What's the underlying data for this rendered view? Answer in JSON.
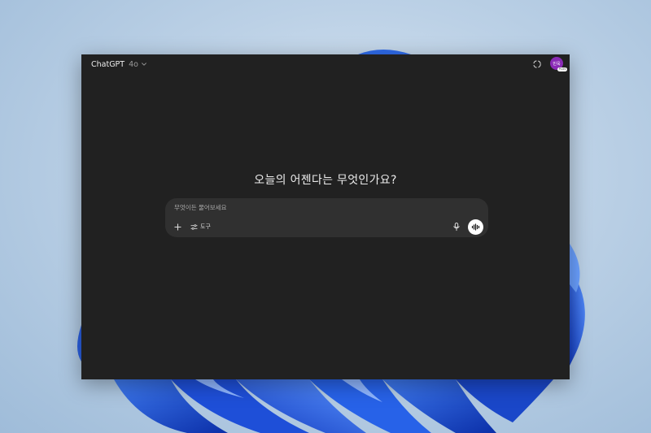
{
  "header": {
    "app_name": "ChatGPT",
    "model_version": "4o",
    "avatar_initials": "민욱",
    "avatar_badge": "PLUS"
  },
  "main": {
    "headline": "오늘의 어젠다는 무엇인가요?",
    "composer": {
      "placeholder": "무엇이든 물어보세요",
      "value": "",
      "tools_label": "도구"
    }
  },
  "icons": {
    "model_chevron": "chevron-down-icon",
    "temporary_chat": "temporary-chat-icon",
    "add": "plus-icon",
    "tools": "tools-icon",
    "microphone": "microphone-icon",
    "voice_mode": "voice-wave-icon"
  },
  "colors": {
    "window_bg": "#212121",
    "composer_bg": "#303030",
    "text": "#ececec",
    "avatar_bg": "#8a2bb6",
    "wallpaper_accent": "#1f55d6"
  }
}
